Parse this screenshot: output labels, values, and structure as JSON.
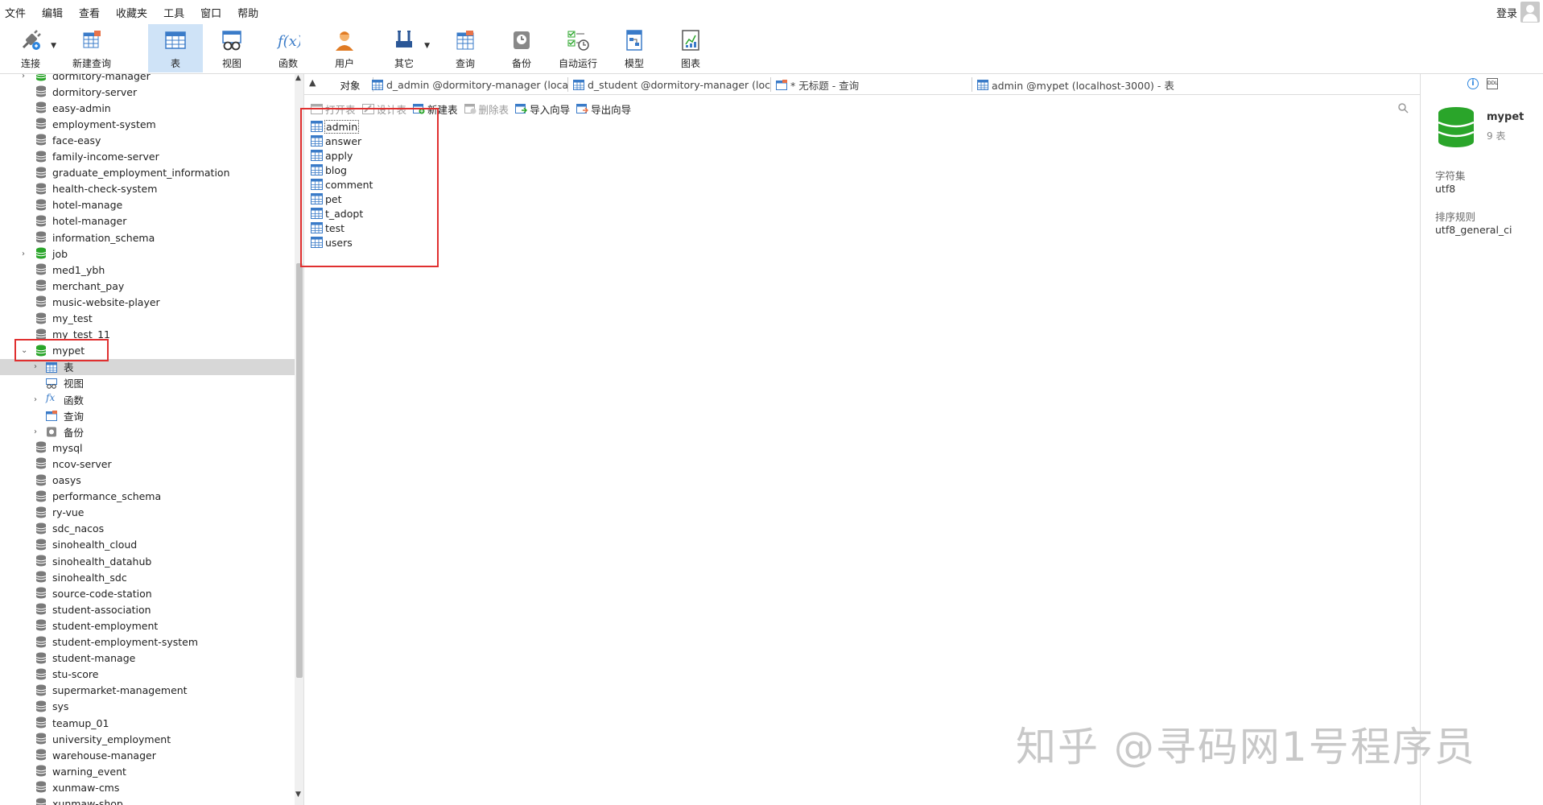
{
  "menubar": {
    "items": [
      "文件",
      "编辑",
      "查看",
      "收藏夹",
      "工具",
      "窗口",
      "帮助"
    ],
    "login_label": "登录"
  },
  "toolbar": {
    "buttons": [
      {
        "label": "连接",
        "icon": "plug-icon"
      },
      {
        "label": "新建查询",
        "icon": "new-query-icon"
      },
      {
        "label": "表",
        "icon": "table-icon"
      },
      {
        "label": "视图",
        "icon": "view-icon"
      },
      {
        "label": "函数",
        "icon": "function-icon"
      },
      {
        "label": "用户",
        "icon": "user-icon"
      },
      {
        "label": "其它",
        "icon": "tools-icon"
      },
      {
        "label": "查询",
        "icon": "query-icon"
      },
      {
        "label": "备份",
        "icon": "backup-icon"
      },
      {
        "label": "自动运行",
        "icon": "schedule-icon"
      },
      {
        "label": "模型",
        "icon": "model-icon"
      },
      {
        "label": "图表",
        "icon": "chart-icon"
      }
    ],
    "active": "表"
  },
  "sidebar": {
    "databases": [
      {
        "name": "dormitory-manager",
        "state": "open-connected"
      },
      {
        "name": "dormitory-server"
      },
      {
        "name": "easy-admin"
      },
      {
        "name": "employment-system"
      },
      {
        "name": "face-easy"
      },
      {
        "name": "family-income-server"
      },
      {
        "name": "graduate_employment_information"
      },
      {
        "name": "health-check-system"
      },
      {
        "name": "hotel-manage"
      },
      {
        "name": "hotel-manager"
      },
      {
        "name": "information_schema"
      },
      {
        "name": "job",
        "state": "connected"
      },
      {
        "name": "med1_ybh"
      },
      {
        "name": "merchant_pay"
      },
      {
        "name": "music-website-player"
      },
      {
        "name": "my_test"
      },
      {
        "name": "my_test_11"
      },
      {
        "name": "mypet",
        "state": "expanded"
      }
    ],
    "mypet_children": [
      {
        "name": "表",
        "icon": "table-icon",
        "expandable": true
      },
      {
        "name": "视图",
        "icon": "view-icon",
        "expandable": false
      },
      {
        "name": "函数",
        "icon": "function-icon",
        "expandable": true
      },
      {
        "name": "查询",
        "icon": "query-icon",
        "expandable": false
      },
      {
        "name": "备份",
        "icon": "backup-icon",
        "expandable": true
      }
    ],
    "databases_after": [
      "mysql",
      "ncov-server",
      "oasys",
      "performance_schema",
      "ry-vue",
      "sdc_nacos",
      "sinohealth_cloud",
      "sinohealth_datahub",
      "sinohealth_sdc",
      "source-code-station",
      "student-association",
      "student-employment",
      "student-employment-system",
      "student-manage",
      "stu-score",
      "supermarket-management",
      "sys",
      "teamup_01",
      "university_employment",
      "warehouse-manager",
      "warning_event",
      "xunmaw-cms",
      "xunmaw-shop"
    ]
  },
  "tabs": {
    "object_label": "对象",
    "items": [
      "d_admin @dormitory-manager (loca...",
      "d_student @dormitory-manager (loc...",
      "* 无标题 - 查询",
      "admin @mypet (localhost-3000) - 表"
    ]
  },
  "objbar": {
    "buttons": [
      {
        "label": "打开表",
        "enabled": false
      },
      {
        "label": "设计表",
        "enabled": false
      },
      {
        "label": "新建表",
        "enabled": true
      },
      {
        "label": "删除表",
        "enabled": false
      },
      {
        "label": "导入向导",
        "enabled": true
      },
      {
        "label": "导出向导",
        "enabled": true
      }
    ]
  },
  "tables": [
    "admin",
    "answer",
    "apply",
    "blog",
    "comment",
    "pet",
    "t_adopt",
    "test",
    "users"
  ],
  "rpanel": {
    "db_name": "mypet",
    "table_count": "9 表",
    "charset_label": "字符集",
    "charset_value": "utf8",
    "collation_label": "排序规则",
    "collation_value": "utf8_general_ci"
  },
  "watermark": "知乎 @寻码网1号程序员",
  "colors": {
    "accent_blue": "#2e86de",
    "db_green": "#2aa52a",
    "highlight_red": "#e03030",
    "active_tool": "#cfe3f7"
  }
}
